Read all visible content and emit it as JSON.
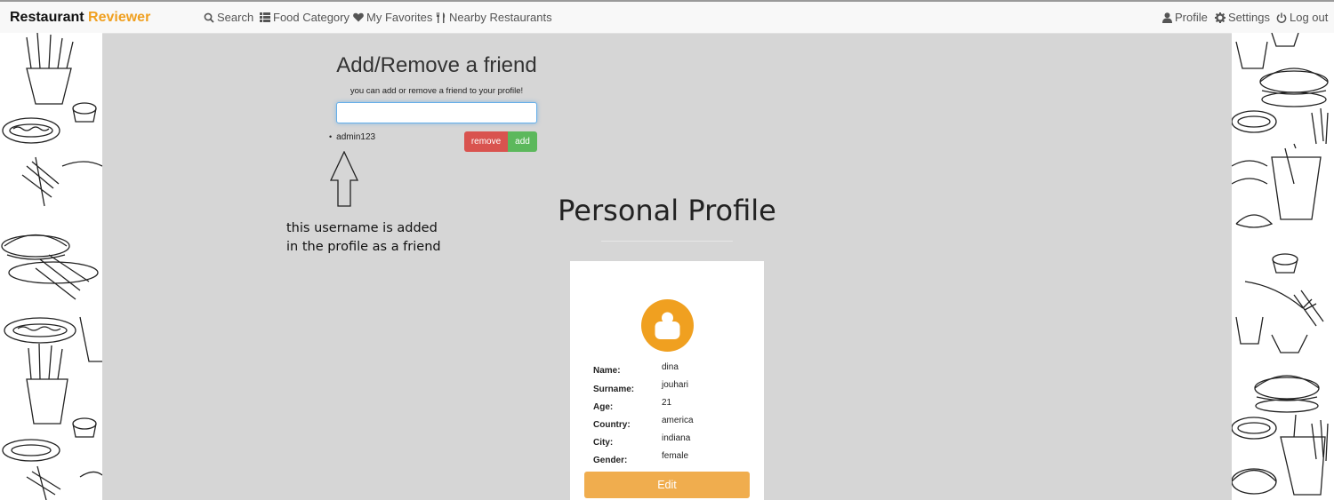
{
  "brand": {
    "name": "Restaurant",
    "accent": "Reviewer",
    "accent_color": "#f0a020"
  },
  "nav": {
    "left": [
      {
        "icon": "search-icon",
        "label": "Search"
      },
      {
        "icon": "list-icon",
        "label": "Food Category"
      },
      {
        "icon": "heart-icon",
        "label": "My Favorites"
      },
      {
        "icon": "cutlery-icon",
        "label": "Nearby Restaurants"
      }
    ],
    "right": [
      {
        "icon": "user-icon",
        "label": "Profile"
      },
      {
        "icon": "gear-icon",
        "label": "Settings"
      },
      {
        "icon": "power-icon",
        "label": "Log out"
      }
    ]
  },
  "friend_panel": {
    "title": "Add/Remove a friend",
    "subtitle": "you can add or remove a friend to your profile!",
    "input_value": "",
    "friends": [
      "admin123"
    ],
    "remove_label": "remove",
    "add_label": "add"
  },
  "annotation": {
    "line1": "this username is added",
    "line2": "in the profile as a friend"
  },
  "profile": {
    "title": "Personal Profile",
    "fields": [
      {
        "label": "Name:",
        "value": "dina"
      },
      {
        "label": "Surname:",
        "value": "jouhari"
      },
      {
        "label": "Age:",
        "value": "21"
      },
      {
        "label": "Country:",
        "value": "america"
      },
      {
        "label": "City:",
        "value": "indiana"
      },
      {
        "label": "Gender:",
        "value": "female"
      }
    ],
    "edit_label": "Edit"
  },
  "colors": {
    "page_bg": "#d6d6d6",
    "remove": "#d9534f",
    "add": "#5cb85c",
    "edit": "#f0ad4e",
    "avatar": "#f0a020"
  }
}
